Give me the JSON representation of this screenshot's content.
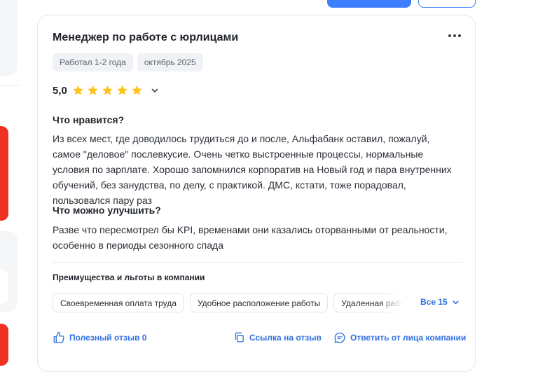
{
  "review": {
    "title": "Менеджер по работе с юрлицами",
    "tags": [
      "Работал 1-2 года",
      "октябрь 2025"
    ],
    "rating": "5,0",
    "stars": 5,
    "likes": {
      "title": "Что нравится?",
      "text": "Из всех мест, где доводилось трудиться до и после, Альфабанк оставил, пожалуй, самое \"деловое\" послевкусие. Очень четко выстроенные процессы, нормальные условия по зарплате. Хорошо запомнился корпоратив на Новый год и пара внутренних обучений, без занудства, по делу, с практикой. ДМС, кстати, тоже порадовал, пользовался пару раз"
    },
    "improve": {
      "title": "Что можно улучшить?",
      "text": "Разве что пересмотрел бы KPI, временами они казались оторванными от реальности, особенно в периоды сезонного спада"
    },
    "benefits": {
      "title": "Преимущества и льготы в компании",
      "chips": [
        "Своевременная оплата труда",
        "Удобное расположение работы",
        "Удаленная работа"
      ],
      "all_label": "Все 15"
    },
    "actions": {
      "helpful": "Полезный отзыв 0",
      "link": "Ссылка на отзыв",
      "reply": "Ответить от лица компании"
    }
  },
  "colors": {
    "accent": "#2f6fe0",
    "star": "#ffc31f",
    "brand_red": "#ef3124",
    "tag_bg": "#f0f2f5"
  }
}
